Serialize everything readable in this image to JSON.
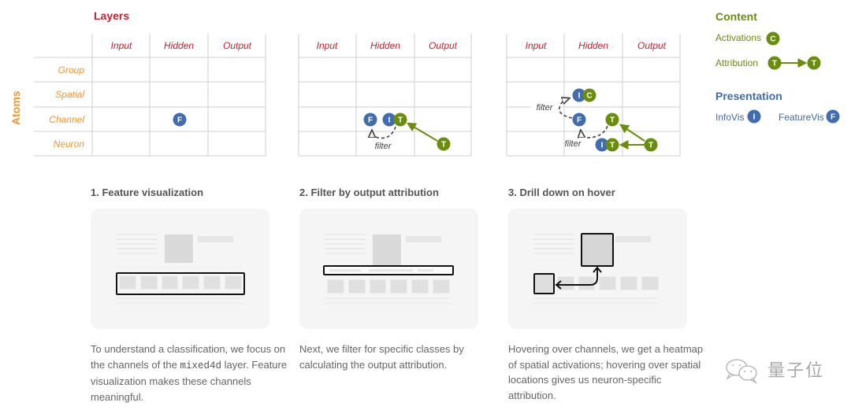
{
  "diagram": {
    "layers_title": "Layers",
    "atoms_title": "Atoms",
    "columns": [
      "Input",
      "Hidden",
      "Output"
    ],
    "rows": [
      "Group",
      "Spatial",
      "Channel",
      "Neuron"
    ],
    "filter_label": "filter",
    "panels": [
      {
        "nodes": [
          {
            "letter": "F",
            "kind": "presentation",
            "row": "Channel",
            "col": "Hidden"
          }
        ]
      },
      {
        "nodes": [
          {
            "letter": "F",
            "kind": "presentation",
            "row": "Channel",
            "col": "Hidden"
          },
          {
            "letter": "I",
            "kind": "presentation",
            "row": "Channel",
            "col": "Hidden"
          },
          {
            "letter": "T",
            "kind": "content",
            "row": "Channel",
            "col": "Hidden"
          },
          {
            "letter": "T",
            "kind": "content",
            "row": "Neuron",
            "col": "Output"
          }
        ],
        "edges": [
          {
            "type": "attribution",
            "from": "Output/Neuron T",
            "to": "Hidden/Channel T"
          },
          {
            "type": "filter",
            "from": "Hidden/Channel T",
            "to": "Hidden/Channel F"
          }
        ]
      },
      {
        "nodes": [
          {
            "letter": "I",
            "kind": "presentation",
            "row": "Spatial",
            "col": "Hidden"
          },
          {
            "letter": "C",
            "kind": "content",
            "row": "Spatial",
            "col": "Hidden"
          },
          {
            "letter": "F",
            "kind": "presentation",
            "row": "Channel",
            "col": "Hidden"
          },
          {
            "letter": "T",
            "kind": "content",
            "row": "Channel",
            "col": "Hidden"
          },
          {
            "letter": "I",
            "kind": "presentation",
            "row": "Neuron",
            "col": "Hidden"
          },
          {
            "letter": "T",
            "kind": "content",
            "row": "Neuron",
            "col": "Hidden"
          },
          {
            "letter": "T",
            "kind": "content",
            "row": "Neuron",
            "col": "Output"
          }
        ],
        "edges": [
          {
            "type": "attribution",
            "from": "Output/Neuron T",
            "to": "Hidden/Channel T"
          },
          {
            "type": "attribution",
            "from": "Output/Neuron T",
            "to": "Hidden/Neuron T"
          },
          {
            "type": "filter",
            "from": "Hidden/Channel T",
            "to": "Hidden/Channel F"
          },
          {
            "type": "filter",
            "from": "Hidden/Channel F",
            "to": "Hidden/Spatial I"
          }
        ]
      }
    ]
  },
  "legend": {
    "content_title": "Content",
    "activations_label": "Activations",
    "activations_letter": "C",
    "attribution_label": "Attribution",
    "attribution_letter": "T",
    "presentation_title": "Presentation",
    "infovis_label": "InfoVis",
    "infovis_letter": "I",
    "featurevis_label": "FeatureVis",
    "featurevis_letter": "F"
  },
  "colors": {
    "layers": "#c8202f",
    "atoms": "#f0962d",
    "content": "#6a8d0d",
    "presentation": "#3f6db0",
    "grid": "#cfcfcf"
  },
  "steps": [
    {
      "title": "1. Feature visualization",
      "desc_pre": "To understand a classification, we focus on the channels of the ",
      "desc_code": "mixed4d",
      "desc_post": " layer. Feature visualization makes these channels meaningful."
    },
    {
      "title": "2. Filter by output attribution",
      "desc": "Next, we filter for specific classes by calculating the output attribution."
    },
    {
      "title": "3. Drill down on hover",
      "desc": "Hovering over channels, we get a heatmap of spatial activations; hovering over spatial locations gives us neuron-specific attribution."
    }
  ],
  "watermark": {
    "text": "量子位",
    "icon": "wechat-icon"
  }
}
